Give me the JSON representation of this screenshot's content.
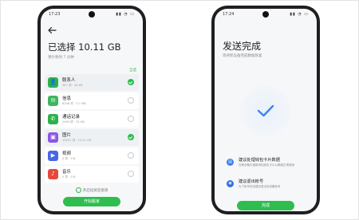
{
  "left_phone": {
    "status_time": "17:23",
    "status_icons": "▮▮ ◔ ▭",
    "title": "已选择 10.11 GB",
    "subtitle": "预计耗时 7 分钟",
    "select_all": "全选",
    "items": [
      {
        "name": "联系人",
        "meta": "387 项 · 28 KB",
        "icon": "contacts-icon",
        "icon_glyph": "👤",
        "color": "#2bb14a",
        "selected": true
      },
      {
        "name": "信息",
        "meta": "8298 项 · 2.1 MB",
        "icon": "message-icon",
        "icon_glyph": "✉",
        "color": "#3fb560",
        "selected": false
      },
      {
        "name": "通话记录",
        "meta": "2999 项 · 31 KB",
        "icon": "phone-icon",
        "icon_glyph": "✆",
        "color": "#2bb14a",
        "selected": false
      },
      {
        "name": "图片",
        "meta": "19021 项 · 10.11 GB",
        "icon": "photos-icon",
        "icon_glyph": "▣",
        "color": "#8c58e4",
        "selected": true
      },
      {
        "name": "视频",
        "meta": "0 项 · 0 B",
        "icon": "video-icon",
        "icon_glyph": "▶",
        "color": "#4a66e8",
        "selected": false
      },
      {
        "name": "音乐",
        "meta": "0 项 · 0 B",
        "icon": "music-icon",
        "icon_glyph": "♪",
        "color": "#e6483b",
        "selected": false
      }
    ],
    "wifi_hint": "开启投屏连接请",
    "start_button": "开始搬家"
  },
  "right_phone": {
    "status_time": "17:24",
    "status_icons": "▮▮ ◔ ▭",
    "title": "发送完成",
    "subtitle": "等待新设备完成数据恢复",
    "tips": [
      {
        "title": "建议处理钱包卡片数据",
        "desc": "在新设备中重新添加钱包卡片以确保正常使用",
        "icon": "wallet-icon",
        "icon_glyph": "▤"
      },
      {
        "title": "建议退出帐号",
        "desc": "为了帐号安全建议退出旧设备帐号",
        "icon": "account-icon",
        "icon_glyph": "◉"
      }
    ],
    "done_button": "完成"
  },
  "colors": {
    "accent_green": "#2fbd4f",
    "accent_blue": "#3d7ff0"
  }
}
